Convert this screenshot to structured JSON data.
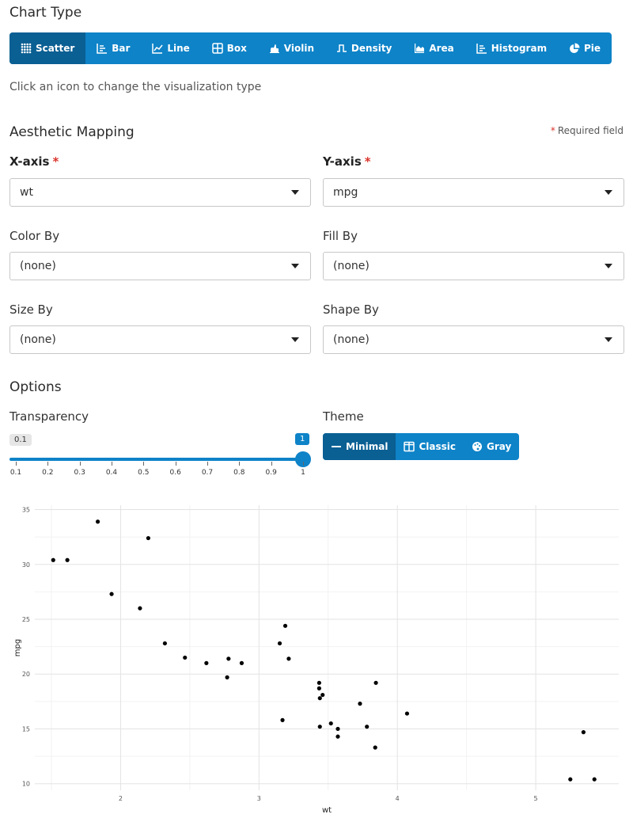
{
  "sections": {
    "chart_type": "Chart Type",
    "aesthetic": "Aesthetic Mapping",
    "options": "Options"
  },
  "chart_tabs": [
    {
      "label": "Scatter",
      "icon": "scatter-icon",
      "active": true
    },
    {
      "label": "Bar",
      "icon": "bar-chart-icon",
      "active": false
    },
    {
      "label": "Line",
      "icon": "line-chart-icon",
      "active": false
    },
    {
      "label": "Box",
      "icon": "box-plot-icon",
      "active": false
    },
    {
      "label": "Violin",
      "icon": "violin-icon",
      "active": false
    },
    {
      "label": "Density",
      "icon": "density-icon",
      "active": false
    },
    {
      "label": "Area",
      "icon": "area-chart-icon",
      "active": false
    },
    {
      "label": "Histogram",
      "icon": "histogram-icon",
      "active": false
    },
    {
      "label": "Pie",
      "icon": "pie-chart-icon",
      "active": false
    }
  ],
  "hint": "Click an icon to change the visualization type",
  "required_note": "Required field",
  "fields": {
    "x_axis": {
      "label": "X-axis",
      "value": "wt"
    },
    "y_axis": {
      "label": "Y-axis",
      "value": "mpg"
    },
    "color_by": {
      "label": "Color By",
      "value": "(none)"
    },
    "fill_by": {
      "label": "Fill By",
      "value": "(none)"
    },
    "size_by": {
      "label": "Size By",
      "value": "(none)"
    },
    "shape_by": {
      "label": "Shape By",
      "value": "(none)"
    }
  },
  "transparency": {
    "label": "Transparency",
    "min_label": "0.1",
    "value": 1,
    "value_label": "1",
    "ticks": [
      "0.1",
      "0.2",
      "0.3",
      "0.4",
      "0.5",
      "0.6",
      "0.7",
      "0.8",
      "0.9",
      "1"
    ]
  },
  "theme": {
    "label": "Theme",
    "options": [
      {
        "label": "Minimal",
        "icon": "minus-icon",
        "active": true
      },
      {
        "label": "Classic",
        "icon": "columns-icon",
        "active": false
      },
      {
        "label": "Gray",
        "icon": "palette-icon",
        "active": false
      }
    ]
  },
  "colors": {
    "accent": "#0e83c8",
    "accent_active": "#0a5f93",
    "required": "#d9342b"
  },
  "chart_data": {
    "type": "scatter",
    "xlabel": "wt",
    "ylabel": "mpg",
    "xlim": [
      1.38,
      5.6
    ],
    "ylim": [
      9.4,
      35.4
    ],
    "xticks": [
      2,
      3,
      4,
      5
    ],
    "yticks": [
      10,
      15,
      20,
      25,
      30,
      35
    ],
    "grid": true,
    "points": [
      [
        1.513,
        30.4
      ],
      [
        1.615,
        30.4
      ],
      [
        1.835,
        33.9
      ],
      [
        1.935,
        27.3
      ],
      [
        2.14,
        26.0
      ],
      [
        2.2,
        32.4
      ],
      [
        2.32,
        22.8
      ],
      [
        2.465,
        21.5
      ],
      [
        2.62,
        21.0
      ],
      [
        2.77,
        19.7
      ],
      [
        2.78,
        21.4
      ],
      [
        2.875,
        21.0
      ],
      [
        3.15,
        22.8
      ],
      [
        3.17,
        15.8
      ],
      [
        3.19,
        24.4
      ],
      [
        3.215,
        21.4
      ],
      [
        3.435,
        19.2
      ],
      [
        3.435,
        18.7
      ],
      [
        3.44,
        17.8
      ],
      [
        3.44,
        15.2
      ],
      [
        3.46,
        18.1
      ],
      [
        3.52,
        15.5
      ],
      [
        3.57,
        15.0
      ],
      [
        3.57,
        14.3
      ],
      [
        3.73,
        17.3
      ],
      [
        3.78,
        15.2
      ],
      [
        3.84,
        13.3
      ],
      [
        3.845,
        19.2
      ],
      [
        4.07,
        16.4
      ],
      [
        5.25,
        10.4
      ],
      [
        5.345,
        14.7
      ],
      [
        5.424,
        10.4
      ]
    ]
  }
}
